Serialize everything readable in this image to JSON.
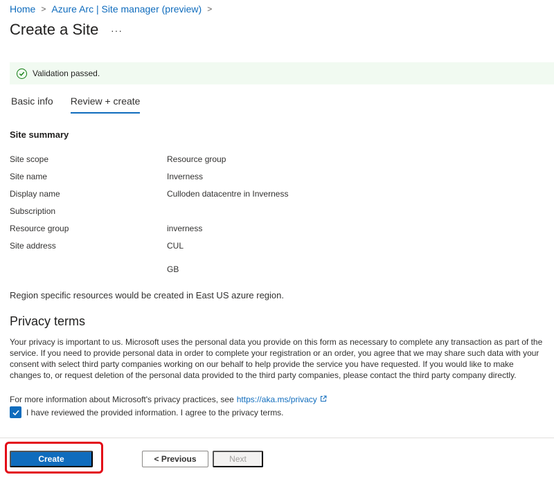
{
  "breadcrumb": {
    "items": [
      "Home",
      "Azure Arc | Site manager (preview)"
    ],
    "separator": ">"
  },
  "header": {
    "title": "Create a Site",
    "more": "···"
  },
  "validation": {
    "message": "Validation passed.",
    "status_color": "#107c10"
  },
  "tabs": [
    {
      "label": "Basic info",
      "active": false
    },
    {
      "label": "Review + create",
      "active": true
    }
  ],
  "summary": {
    "title": "Site summary",
    "rows": [
      {
        "label": "Site scope",
        "value": "Resource group"
      },
      {
        "label": "Site name",
        "value": "Inverness"
      },
      {
        "label": "Display name",
        "value": "Culloden datacentre in Inverness"
      },
      {
        "label": "Subscription",
        "value": ""
      },
      {
        "label": "Resource group",
        "value": "inverness"
      },
      {
        "label": "Site address",
        "value": "CUL"
      },
      {
        "label": "",
        "value": "GB"
      }
    ]
  },
  "region_note": "Region specific resources would be created in East US azure region.",
  "privacy": {
    "title": "Privacy terms",
    "body": "Your privacy is important to us. Microsoft uses the personal data you provide on this form as necessary to complete any transaction as part of the service. If you need to provide personal data in order to complete your registration or an order, you agree that we may share such data with your consent with select third party companies working on our behalf to help provide the service you have requested. If you would like to make changes to, or request deletion of the personal data provided to the third party companies, please contact the third party company directly.",
    "more_info_prefix": "For more information about Microsoft's privacy practices, see",
    "link": "https://aka.ms/privacy",
    "agree_label": "I have reviewed the provided information. I agree to the privacy terms.",
    "agreed": true
  },
  "footer": {
    "create_label": "Create",
    "previous_label": "< Previous",
    "next_label": "Next"
  },
  "colors": {
    "accent": "#0f6cbd",
    "highlight": "#e30b17",
    "success_bg": "#f1faf1"
  }
}
